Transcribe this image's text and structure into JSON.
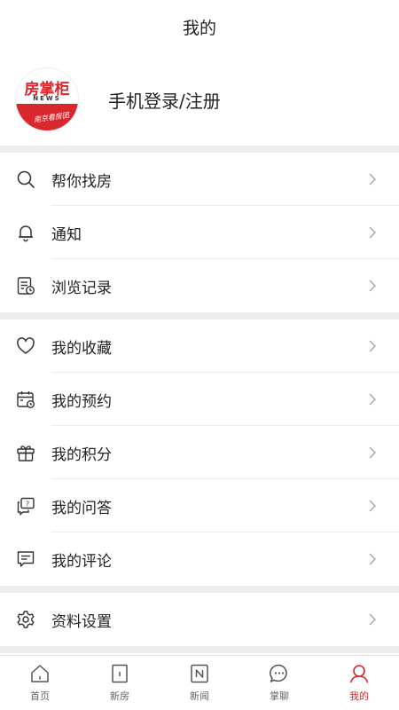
{
  "header": {
    "title": "我的"
  },
  "profile": {
    "logo": {
      "brand": "房掌柜",
      "sub": "NEWS",
      "slogan": "南京看房团"
    },
    "login_label": "手机登录/注册"
  },
  "menu_groups": [
    [
      {
        "label": "帮你找房",
        "icon": "search-icon"
      },
      {
        "label": "通知",
        "icon": "bell-icon"
      },
      {
        "label": "浏览记录",
        "icon": "history-icon"
      }
    ],
    [
      {
        "label": "我的收藏",
        "icon": "heart-icon"
      },
      {
        "label": "我的预约",
        "icon": "calendar-icon"
      },
      {
        "label": "我的积分",
        "icon": "gift-icon"
      },
      {
        "label": "我的问答",
        "icon": "qa-icon"
      },
      {
        "label": "我的评论",
        "icon": "comment-icon"
      }
    ],
    [
      {
        "label": "资料设置",
        "icon": "gear-icon"
      }
    ]
  ],
  "tabbar": [
    {
      "label": "首页",
      "icon": "home-icon",
      "active": false
    },
    {
      "label": "新房",
      "icon": "door-icon",
      "active": false
    },
    {
      "label": "新闻",
      "icon": "news-icon",
      "active": false
    },
    {
      "label": "掌聊",
      "icon": "chat-icon",
      "active": false
    },
    {
      "label": "我的",
      "icon": "profile-icon",
      "active": true
    }
  ],
  "colors": {
    "accent": "#d9272e",
    "text": "#222222",
    "divider": "#ededed",
    "icon": "#333333"
  }
}
